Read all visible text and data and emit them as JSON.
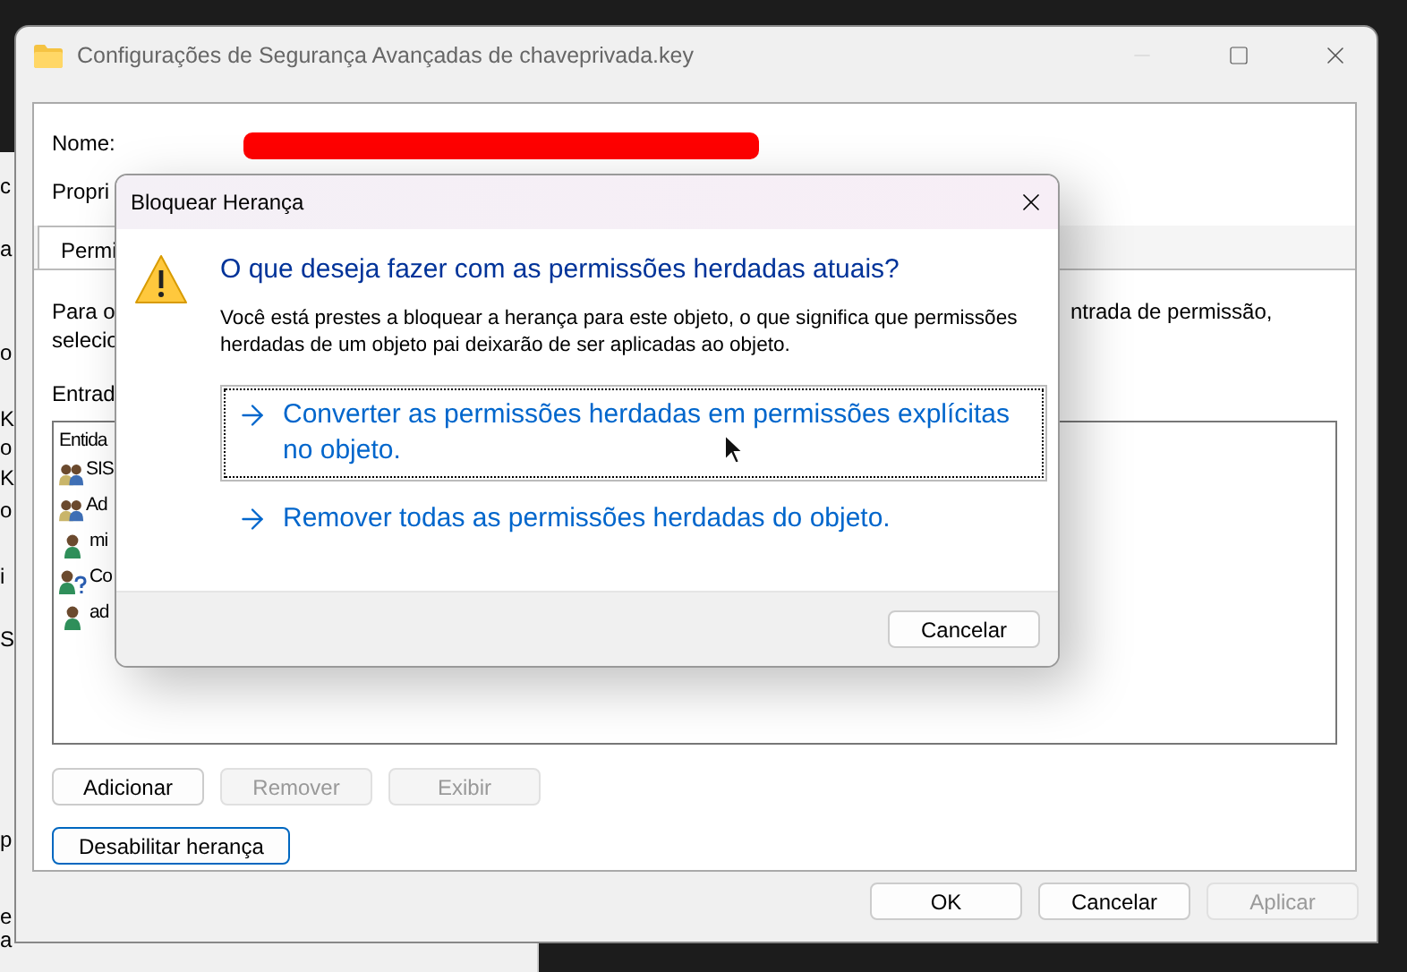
{
  "background_window": {
    "fragments": [
      "c",
      "a",
      "o",
      "K",
      "o",
      "K",
      "o",
      "i",
      "S",
      "p",
      "e",
      "a"
    ]
  },
  "window": {
    "title": "Configurações de Segurança Avançadas de chaveprivada.key",
    "name_label": "Nome:",
    "owner_label": "Propri",
    "tabs": [
      {
        "label": "Permi",
        "selected": true
      }
    ],
    "description_lines": [
      "Para o",
      "selecio"
    ],
    "description_right": "ntrada de permissão,",
    "entries_label": "Entrad",
    "entries_header": "Entida",
    "entries": [
      {
        "name": "SIS",
        "kind": "group"
      },
      {
        "name": "Ad",
        "kind": "group"
      },
      {
        "name": "mi",
        "kind": "user"
      },
      {
        "name": "Co",
        "kind": "unknown"
      },
      {
        "name": "ad",
        "kind": "user"
      }
    ],
    "entry_buttons": [
      {
        "label": "Adicionar",
        "disabled": false
      },
      {
        "label": "Remover",
        "disabled": true
      },
      {
        "label": "Exibir",
        "disabled": true
      }
    ],
    "inheritance_button": {
      "label": "Desabilitar herança",
      "focused": true
    },
    "footer_buttons": [
      {
        "label": "OK",
        "disabled": false
      },
      {
        "label": "Cancelar",
        "disabled": false
      },
      {
        "label": "Aplicar",
        "disabled": true
      }
    ]
  },
  "dialog": {
    "title": "Bloquear Herança",
    "heading": "O que deseja fazer com as permissões herdadas atuais?",
    "message": "Você está prestes a bloquear a herança para este objeto, o que significa que permissões herdadas de um objeto pai deixarão de ser aplicadas ao objeto.",
    "options": [
      {
        "label": "Converter as permissões herdadas em permissões explícitas no objeto.",
        "focused": true
      },
      {
        "label": "Remover todas as permissões herdadas do objeto.",
        "focused": false
      }
    ],
    "cancel": "Cancelar"
  }
}
